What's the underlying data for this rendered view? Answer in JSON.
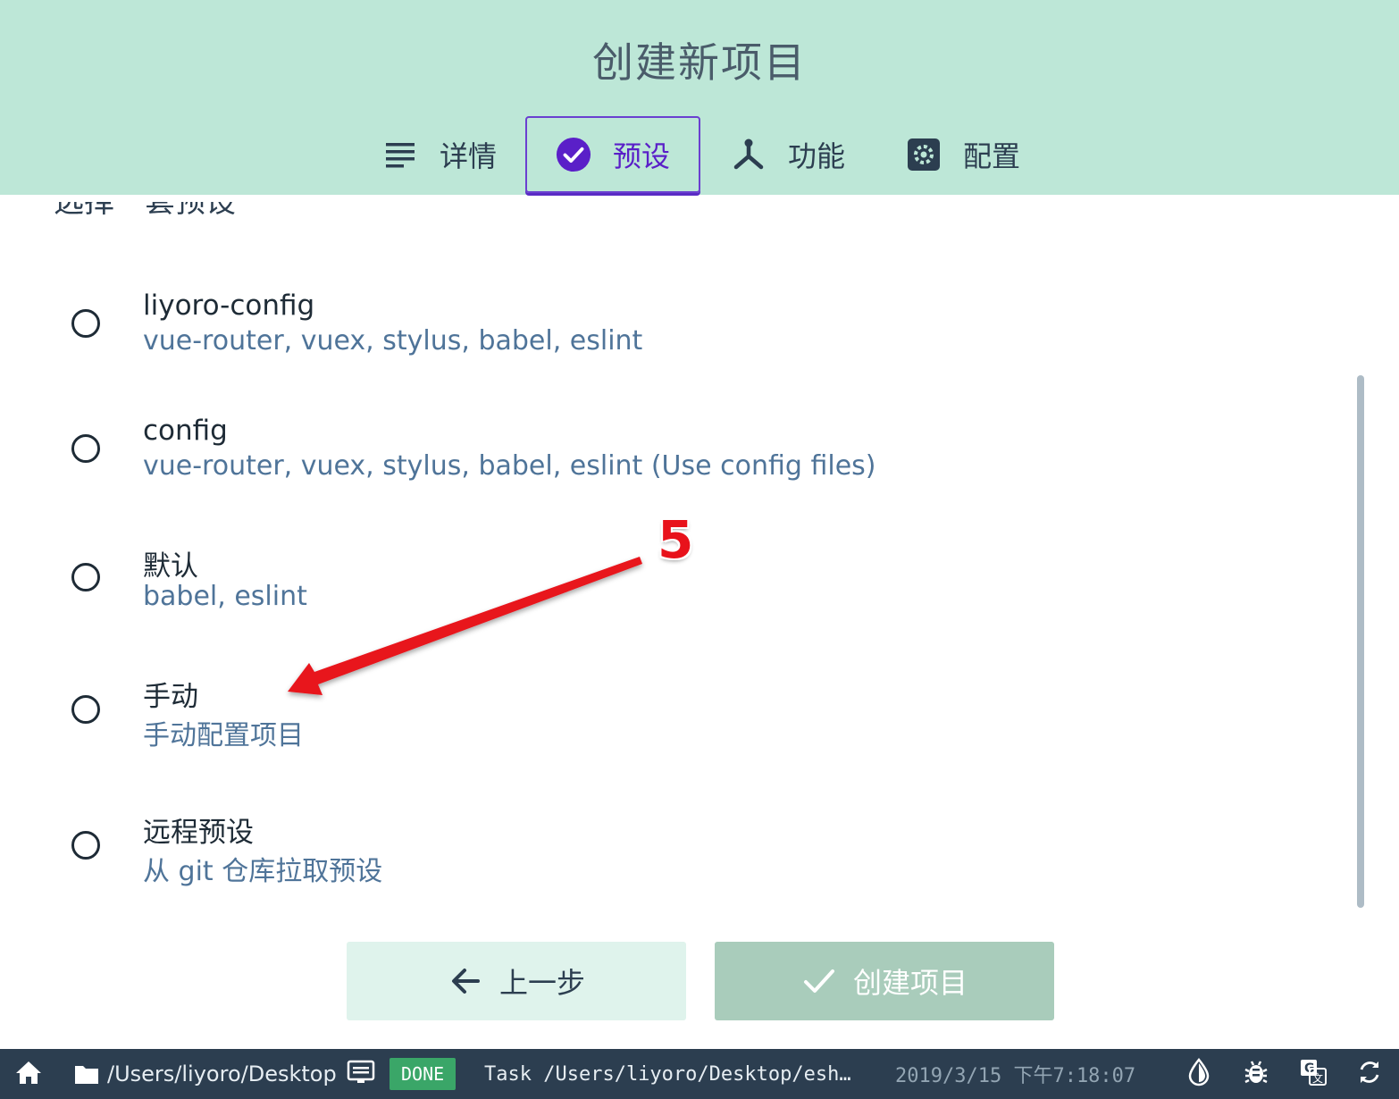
{
  "header": {
    "title": "创建新项目",
    "tabs": [
      {
        "label": "详情",
        "icon": "list-icon",
        "active": false
      },
      {
        "label": "预设",
        "icon": "check-circle-icon",
        "active": true
      },
      {
        "label": "功能",
        "icon": "call-split-icon",
        "active": false
      },
      {
        "label": "配置",
        "icon": "settings-icon",
        "active": false
      }
    ]
  },
  "main": {
    "section_label_partial": "选择一套预设",
    "options": [
      {
        "name": "liyoro-config",
        "description": "vue-router, vuex, stylus, babel, eslint",
        "selected": false
      },
      {
        "name": "config",
        "description": "vue-router, vuex, stylus, babel, eslint (Use config files)",
        "selected": false
      },
      {
        "name": "默认",
        "description": "babel, eslint",
        "selected": false
      },
      {
        "name": "手动",
        "description": "手动配置项目",
        "selected": false
      },
      {
        "name": "远程预设",
        "description": "从 git 仓库拉取预设",
        "selected": false
      }
    ]
  },
  "annotation": {
    "number": "5",
    "color": "#e8121b"
  },
  "actions": {
    "prev_label": "上一步",
    "create_label": "创建项目"
  },
  "statusbar": {
    "path": "/Users/liyoro/Desktop",
    "status_badge": "DONE",
    "task": "Task  /Users/liyoro/Desktop/esh…",
    "timestamp": "2019/3/15  下午7:18:07"
  },
  "colors": {
    "header_bg": "#bde7d7",
    "accent": "#5a1fc8",
    "statusbar_bg": "#2c3e50",
    "done_badge": "#3aa668"
  }
}
